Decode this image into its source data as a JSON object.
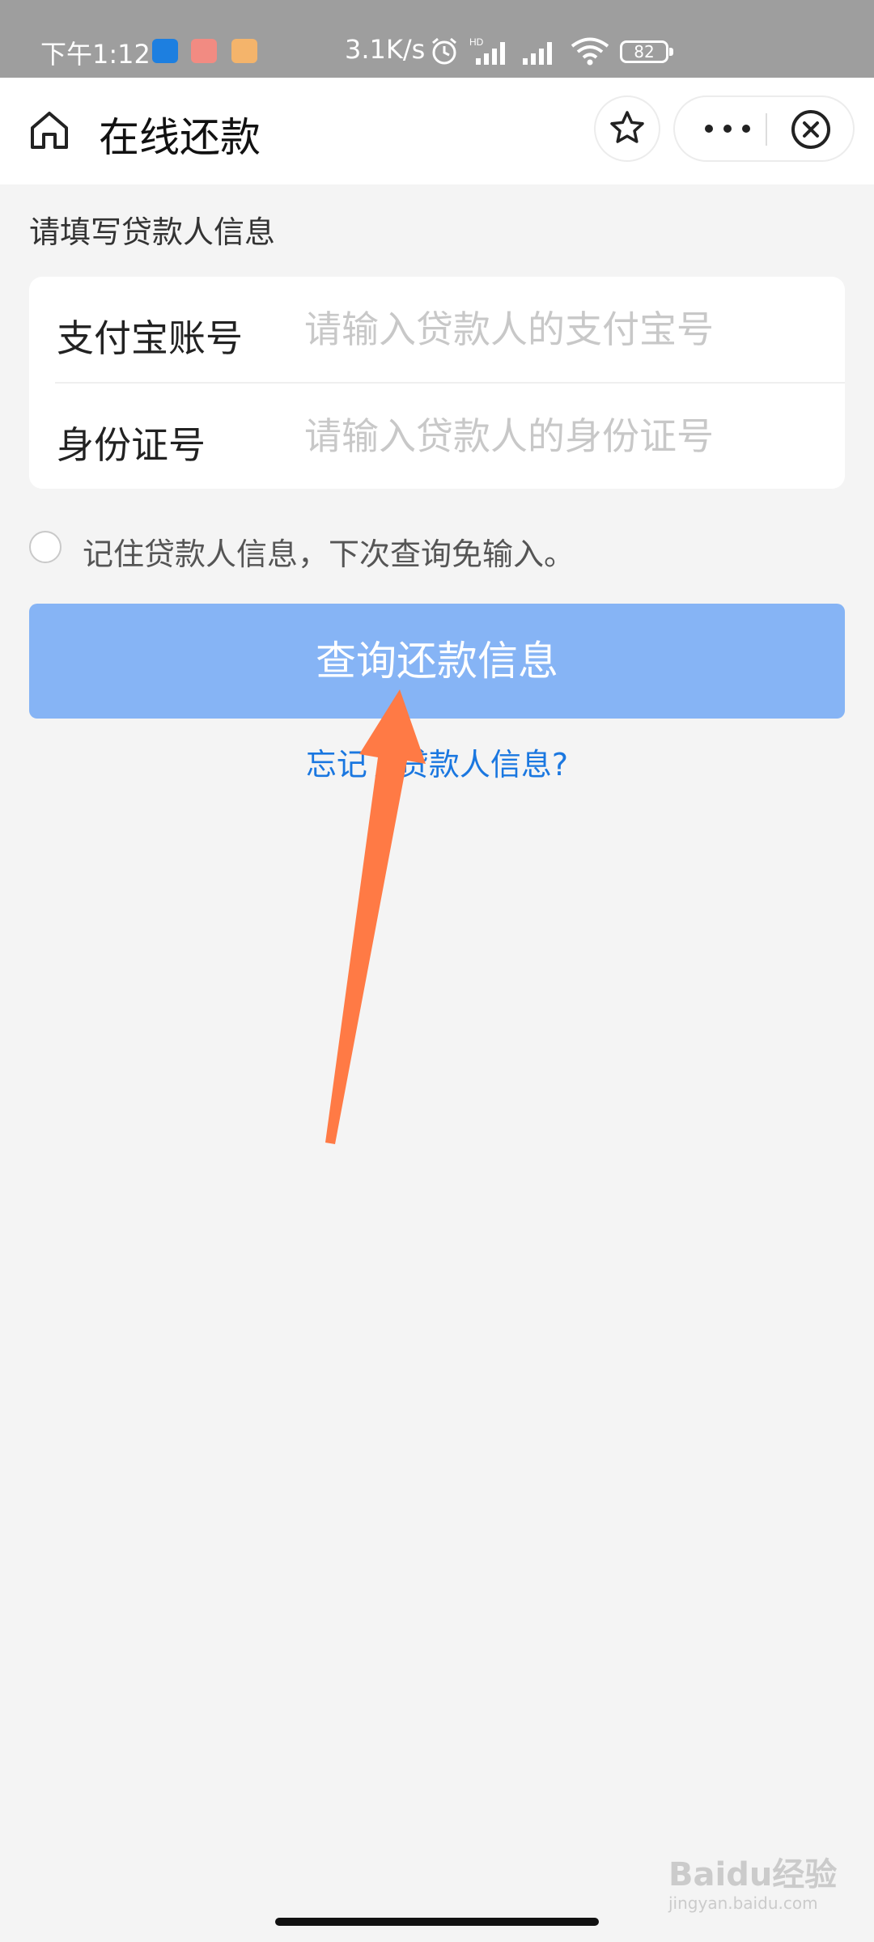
{
  "status_bar": {
    "time": "下午1:12",
    "net_speed": "3.1K/s",
    "battery": "82",
    "icons": [
      "alarm-icon",
      "hd-signal-icon",
      "signal-icon",
      "wifi-icon",
      "battery-icon"
    ]
  },
  "nav": {
    "title": "在线还款",
    "icons": [
      "home-icon",
      "star-icon",
      "more-icon",
      "close-icon"
    ]
  },
  "form": {
    "section_label": "请填写贷款人信息",
    "fields": [
      {
        "label": "支付宝账号",
        "placeholder": "请输入贷款人的支付宝号",
        "value": ""
      },
      {
        "label": "身份证号",
        "placeholder": "请输入贷款人的身份证号",
        "value": ""
      }
    ],
    "remember_label": "记住贷款人信息，下次查询免输入。",
    "remember_checked": false,
    "submit_label": "查询还款信息",
    "forgot_link": "忘记了贷款人信息?"
  },
  "colors": {
    "button": "#86b4f5",
    "link": "#1a77e0",
    "annotation_arrow": "#ff7a45",
    "status_bar": "#9e9e9e"
  },
  "watermark": {
    "brand": "Baidu经验",
    "url": "jingyan.baidu.com"
  }
}
